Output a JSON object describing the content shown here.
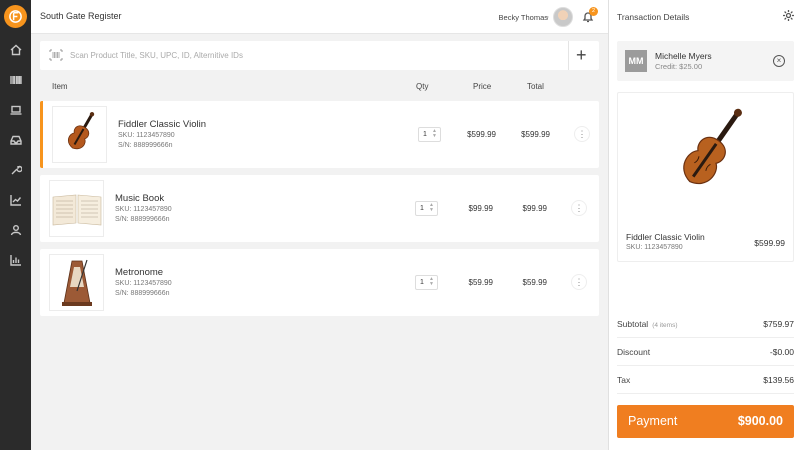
{
  "header": {
    "store_title": "South Gate Register",
    "user_name": "Becky Thomas",
    "notification_count": "2"
  },
  "search": {
    "placeholder": "Scan Product Title, SKU, UPC, ID, Alternitive IDs"
  },
  "columns": {
    "item": "Item",
    "qty": "Qty",
    "price": "Price",
    "total": "Total"
  },
  "items": [
    {
      "name": "Fiddler Classic Violin",
      "sku": "SKU: 1123457890",
      "sn": "S/N: 888999666n",
      "qty": "1",
      "price": "$599.99",
      "total": "$599.99",
      "icon": "violin-image"
    },
    {
      "name": "Music Book",
      "sku": "SKU: 1123457890",
      "sn": "S/N: 888999666n",
      "qty": "1",
      "price": "$99.99",
      "total": "$99.99",
      "icon": "music-book-image"
    },
    {
      "name": "Metronome",
      "sku": "SKU: 1123457890",
      "sn": "S/N: 888999666n",
      "qty": "1",
      "price": "$59.99",
      "total": "$59.99",
      "icon": "metronome-image"
    }
  ],
  "transaction": {
    "title": "Transaction Details",
    "customer": {
      "initials": "MM",
      "name": "Michelle Myers",
      "credit": "Credit: $25.00"
    },
    "preview": {
      "name": "Fiddler Classic Violin",
      "sku": "SKU: 1123457890",
      "price": "$599.99"
    },
    "subtotal_label": "Subtotal",
    "subtotal_count": "(4 items)",
    "subtotal": "$759.97",
    "discount_label": "Discount",
    "discount": "-$0.00",
    "tax_label": "Tax",
    "tax": "$139.56",
    "payment_label": "Payment",
    "payment_amount": "$900.00"
  },
  "colors": {
    "accent": "#f7941d",
    "payment": "#f07e20",
    "rail": "#2b2b2b"
  }
}
